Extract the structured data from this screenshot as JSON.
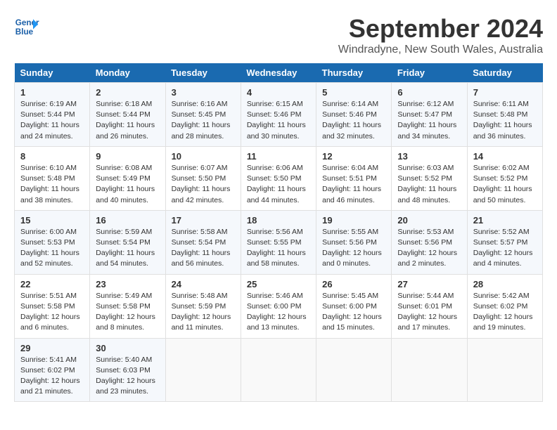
{
  "header": {
    "logo_line1": "General",
    "logo_line2": "Blue",
    "month": "September 2024",
    "location": "Windradyne, New South Wales, Australia"
  },
  "weekdays": [
    "Sunday",
    "Monday",
    "Tuesday",
    "Wednesday",
    "Thursday",
    "Friday",
    "Saturday"
  ],
  "weeks": [
    [
      {
        "day": "1",
        "lines": [
          "Sunrise: 6:19 AM",
          "Sunset: 5:44 PM",
          "Daylight: 11 hours",
          "and 24 minutes."
        ]
      },
      {
        "day": "2",
        "lines": [
          "Sunrise: 6:18 AM",
          "Sunset: 5:44 PM",
          "Daylight: 11 hours",
          "and 26 minutes."
        ]
      },
      {
        "day": "3",
        "lines": [
          "Sunrise: 6:16 AM",
          "Sunset: 5:45 PM",
          "Daylight: 11 hours",
          "and 28 minutes."
        ]
      },
      {
        "day": "4",
        "lines": [
          "Sunrise: 6:15 AM",
          "Sunset: 5:46 PM",
          "Daylight: 11 hours",
          "and 30 minutes."
        ]
      },
      {
        "day": "5",
        "lines": [
          "Sunrise: 6:14 AM",
          "Sunset: 5:46 PM",
          "Daylight: 11 hours",
          "and 32 minutes."
        ]
      },
      {
        "day": "6",
        "lines": [
          "Sunrise: 6:12 AM",
          "Sunset: 5:47 PM",
          "Daylight: 11 hours",
          "and 34 minutes."
        ]
      },
      {
        "day": "7",
        "lines": [
          "Sunrise: 6:11 AM",
          "Sunset: 5:48 PM",
          "Daylight: 11 hours",
          "and 36 minutes."
        ]
      }
    ],
    [
      {
        "day": "8",
        "lines": [
          "Sunrise: 6:10 AM",
          "Sunset: 5:48 PM",
          "Daylight: 11 hours",
          "and 38 minutes."
        ]
      },
      {
        "day": "9",
        "lines": [
          "Sunrise: 6:08 AM",
          "Sunset: 5:49 PM",
          "Daylight: 11 hours",
          "and 40 minutes."
        ]
      },
      {
        "day": "10",
        "lines": [
          "Sunrise: 6:07 AM",
          "Sunset: 5:50 PM",
          "Daylight: 11 hours",
          "and 42 minutes."
        ]
      },
      {
        "day": "11",
        "lines": [
          "Sunrise: 6:06 AM",
          "Sunset: 5:50 PM",
          "Daylight: 11 hours",
          "and 44 minutes."
        ]
      },
      {
        "day": "12",
        "lines": [
          "Sunrise: 6:04 AM",
          "Sunset: 5:51 PM",
          "Daylight: 11 hours",
          "and 46 minutes."
        ]
      },
      {
        "day": "13",
        "lines": [
          "Sunrise: 6:03 AM",
          "Sunset: 5:52 PM",
          "Daylight: 11 hours",
          "and 48 minutes."
        ]
      },
      {
        "day": "14",
        "lines": [
          "Sunrise: 6:02 AM",
          "Sunset: 5:52 PM",
          "Daylight: 11 hours",
          "and 50 minutes."
        ]
      }
    ],
    [
      {
        "day": "15",
        "lines": [
          "Sunrise: 6:00 AM",
          "Sunset: 5:53 PM",
          "Daylight: 11 hours",
          "and 52 minutes."
        ]
      },
      {
        "day": "16",
        "lines": [
          "Sunrise: 5:59 AM",
          "Sunset: 5:54 PM",
          "Daylight: 11 hours",
          "and 54 minutes."
        ]
      },
      {
        "day": "17",
        "lines": [
          "Sunrise: 5:58 AM",
          "Sunset: 5:54 PM",
          "Daylight: 11 hours",
          "and 56 minutes."
        ]
      },
      {
        "day": "18",
        "lines": [
          "Sunrise: 5:56 AM",
          "Sunset: 5:55 PM",
          "Daylight: 11 hours",
          "and 58 minutes."
        ]
      },
      {
        "day": "19",
        "lines": [
          "Sunrise: 5:55 AM",
          "Sunset: 5:56 PM",
          "Daylight: 12 hours",
          "and 0 minutes."
        ]
      },
      {
        "day": "20",
        "lines": [
          "Sunrise: 5:53 AM",
          "Sunset: 5:56 PM",
          "Daylight: 12 hours",
          "and 2 minutes."
        ]
      },
      {
        "day": "21",
        "lines": [
          "Sunrise: 5:52 AM",
          "Sunset: 5:57 PM",
          "Daylight: 12 hours",
          "and 4 minutes."
        ]
      }
    ],
    [
      {
        "day": "22",
        "lines": [
          "Sunrise: 5:51 AM",
          "Sunset: 5:58 PM",
          "Daylight: 12 hours",
          "and 6 minutes."
        ]
      },
      {
        "day": "23",
        "lines": [
          "Sunrise: 5:49 AM",
          "Sunset: 5:58 PM",
          "Daylight: 12 hours",
          "and 8 minutes."
        ]
      },
      {
        "day": "24",
        "lines": [
          "Sunrise: 5:48 AM",
          "Sunset: 5:59 PM",
          "Daylight: 12 hours",
          "and 11 minutes."
        ]
      },
      {
        "day": "25",
        "lines": [
          "Sunrise: 5:46 AM",
          "Sunset: 6:00 PM",
          "Daylight: 12 hours",
          "and 13 minutes."
        ]
      },
      {
        "day": "26",
        "lines": [
          "Sunrise: 5:45 AM",
          "Sunset: 6:00 PM",
          "Daylight: 12 hours",
          "and 15 minutes."
        ]
      },
      {
        "day": "27",
        "lines": [
          "Sunrise: 5:44 AM",
          "Sunset: 6:01 PM",
          "Daylight: 12 hours",
          "and 17 minutes."
        ]
      },
      {
        "day": "28",
        "lines": [
          "Sunrise: 5:42 AM",
          "Sunset: 6:02 PM",
          "Daylight: 12 hours",
          "and 19 minutes."
        ]
      }
    ],
    [
      {
        "day": "29",
        "lines": [
          "Sunrise: 5:41 AM",
          "Sunset: 6:02 PM",
          "Daylight: 12 hours",
          "and 21 minutes."
        ]
      },
      {
        "day": "30",
        "lines": [
          "Sunrise: 5:40 AM",
          "Sunset: 6:03 PM",
          "Daylight: 12 hours",
          "and 23 minutes."
        ]
      },
      {
        "day": "",
        "lines": []
      },
      {
        "day": "",
        "lines": []
      },
      {
        "day": "",
        "lines": []
      },
      {
        "day": "",
        "lines": []
      },
      {
        "day": "",
        "lines": []
      }
    ]
  ]
}
